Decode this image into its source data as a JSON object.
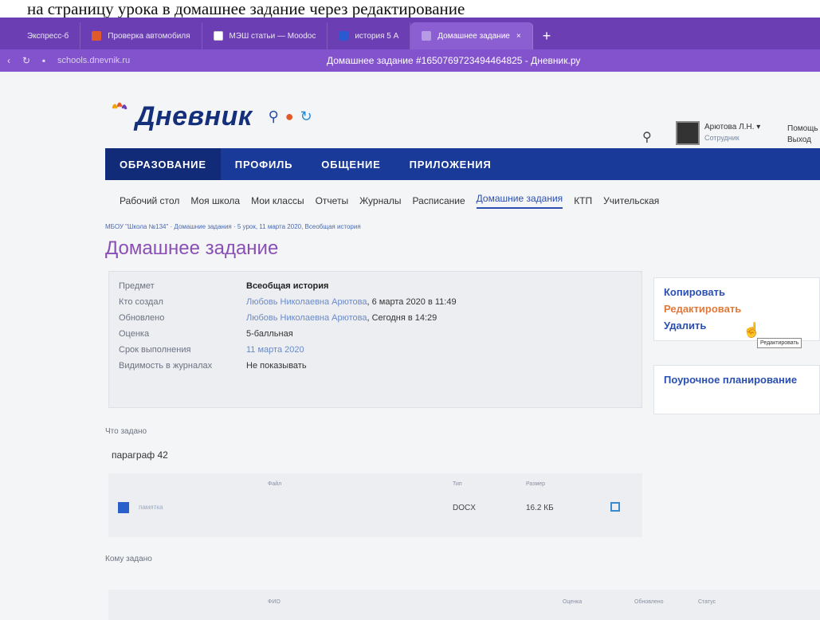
{
  "caption": "на страницу урока в домашнее задание через редактирование",
  "browser": {
    "tabs": [
      {
        "label": "Экспресс-б",
        "color": "#6b3fb3"
      },
      {
        "label": "Проверка автомобиля",
        "color": "#e05a2a"
      },
      {
        "label": "МЭШ статьи — Moodoc",
        "color": "#ffffff"
      },
      {
        "label": "история 5 А",
        "color": "#2a5ad0"
      },
      {
        "label": "Домашнее задание",
        "color": "#b79ae6",
        "active": true
      }
    ],
    "new_tab": "+",
    "url": "schools.dnevnik.ru",
    "page_title": "Домашнее задание #1650769723494464825 - Дневник.ру"
  },
  "header": {
    "logo": "Дневник",
    "user_name": "Арютова Л.Н. ▾",
    "user_role": "Сотрудник",
    "help": "Помощь",
    "logout": "Выход"
  },
  "mainnav": [
    "ОБРАЗОВАНИЕ",
    "ПРОФИЛЬ",
    "ОБЩЕНИЕ",
    "ПРИЛОЖЕНИЯ"
  ],
  "subnav": [
    "Рабочий стол",
    "Моя школа",
    "Мои классы",
    "Отчеты",
    "Журналы",
    "Расписание",
    "Домашние задания",
    "КТП",
    "Учительская"
  ],
  "breadcrumb": "МБОУ \"Школа №134\" · Домашние задания · 5 урок, 11 марта 2020, Всеобщая история",
  "page_heading": "Домашнее задание",
  "info": {
    "subject_label": "Предмет",
    "subject": "Всеобщая история",
    "created_label": "Кто создал",
    "created_by": "Любовь Николаевна Арютова",
    "created_at": ", 6 марта 2020 в 11:49",
    "updated_label": "Обновлено",
    "updated_by": "Любовь Николаевна Арютова",
    "updated_at": ", Сегодня в 14:29",
    "grade_label": "Оценка",
    "grade": "5-балльная",
    "due_label": "Срок выполнения",
    "due": "11 марта 2020",
    "visibility_label": "Видимость в журналах",
    "visibility": "Не показывать"
  },
  "actions": {
    "copy": "Копировать",
    "edit": "Редактировать",
    "delete": "Удалить",
    "tooltip": "Редактировать",
    "plan": "Поурочное планирование"
  },
  "task": {
    "label": "Что задано",
    "text": "параграф 42"
  },
  "files": {
    "col_file": "Файл",
    "col_type": "Тип",
    "col_size": "Размер",
    "name": "памятка",
    "type": "DOCX",
    "size": "16.2 КБ"
  },
  "whom": {
    "label": "Кому задано"
  },
  "bottom": {
    "col_name": "ФИО",
    "col_grade": "Оценка",
    "col_updated": "Обновлено",
    "col_status": "Статус"
  }
}
